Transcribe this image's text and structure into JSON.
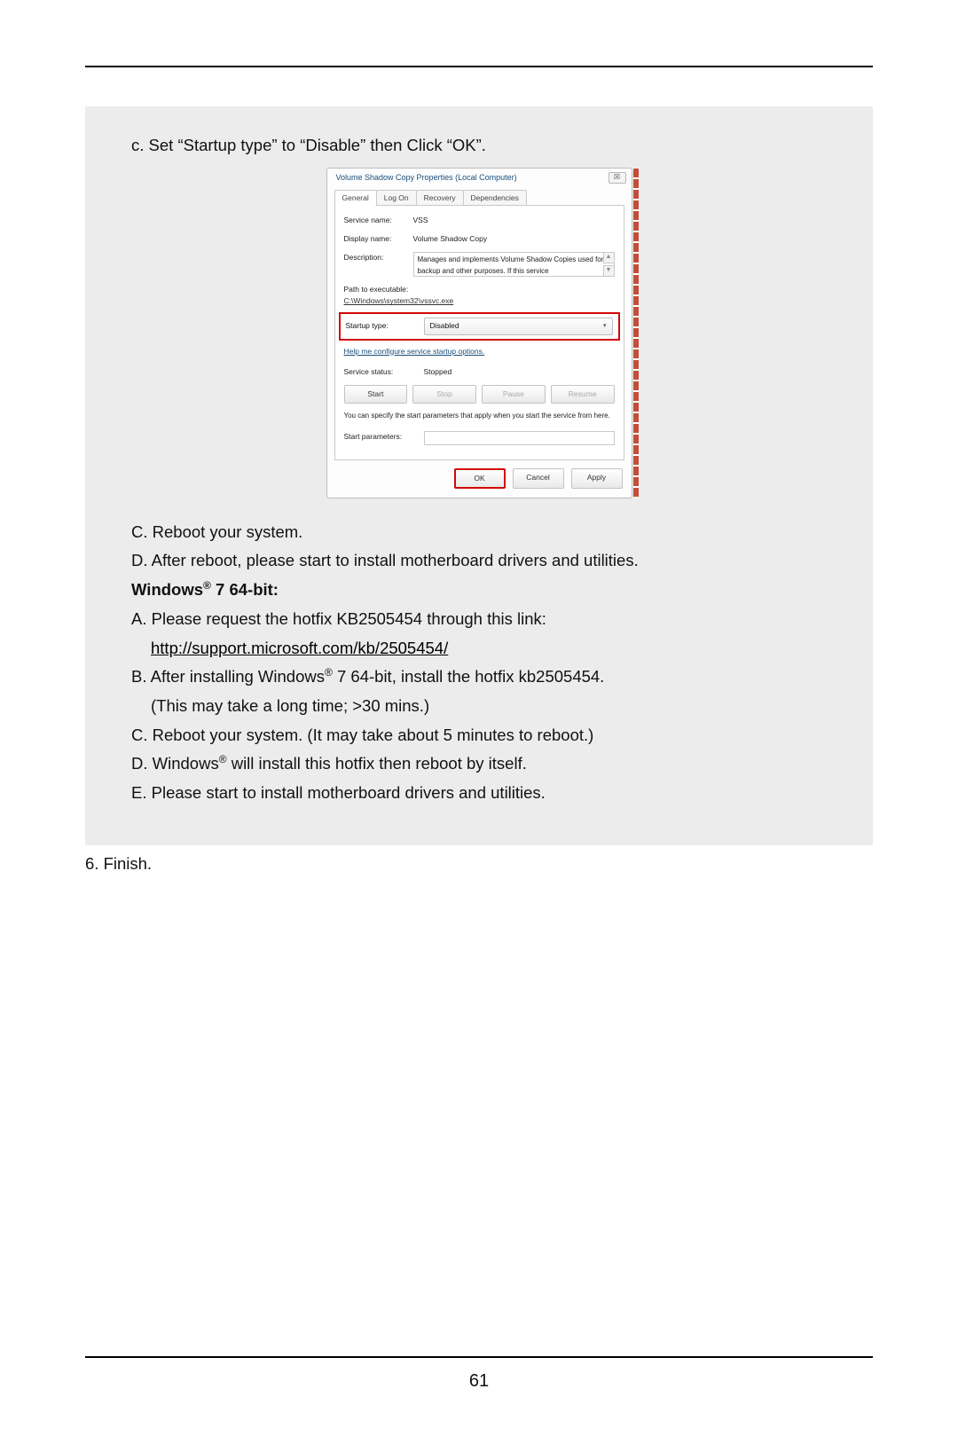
{
  "step_c_sub": "c. Set “Startup type” to “Disable” then Click “OK”.",
  "dialog": {
    "title": "Volume Shadow Copy Properties (Local Computer)",
    "close_glyph": "☒",
    "tabs": {
      "general": "General",
      "logon": "Log On",
      "recovery": "Recovery",
      "dependencies": "Dependencies"
    },
    "service_name_label": "Service name:",
    "service_name_value": "VSS",
    "display_name_label": "Display name:",
    "display_name_value": "Volume Shadow Copy",
    "description_label": "Description:",
    "description_value": "Manages and implements Volume Shadow Copies used for backup and other purposes. If this service",
    "scroll_up": "▲",
    "scroll_dn": "▼",
    "path_label": "Path to executable:",
    "path_value": "C:\\Windows\\system32\\vssvc.exe",
    "startup_label": "Startup type:",
    "startup_value": "Disabled",
    "caret": "▾",
    "configure_link": "Help me configure service startup options.",
    "service_status_label": "Service status:",
    "service_status_value": "Stopped",
    "btn_start": "Start",
    "btn_stop": "Stop",
    "btn_pause": "Pause",
    "btn_resume": "Resume",
    "note": "You can specify the start parameters that apply when you start the service from here.",
    "start_params_label": "Start parameters:",
    "btn_ok": "OK",
    "btn_cancel": "Cancel",
    "btn_apply": "Apply"
  },
  "step_C": "C. Reboot your system.",
  "step_D": "D. After reboot, please start to install motherboard drivers and utilities.",
  "win7_heading_pre": "Windows",
  "win7_heading_sup": "®",
  "win7_heading_post": " 7 64-bit:",
  "win7_A": "A. Please request the hotfix KB2505454 through this link:",
  "win7_A_link": "http://support.microsoft.com/kb/2505454/",
  "win7_B_pre": "B. After installing Windows",
  "win7_B_sup": "®",
  "win7_B_post": " 7 64-bit, install the hotfix kb2505454.",
  "win7_B2": "(This may take a long time; >30 mins.)",
  "win7_C": "C. Reboot your system. (It may take about 5 minutes to reboot.)",
  "win7_D_pre": "D. Windows",
  "win7_D_sup": "®",
  "win7_D_post": " will install this hotfix then reboot by itself.",
  "win7_E": "E. Please start to install motherboard drivers and utilities.",
  "step6": "6. Finish.",
  "page_number": "61"
}
